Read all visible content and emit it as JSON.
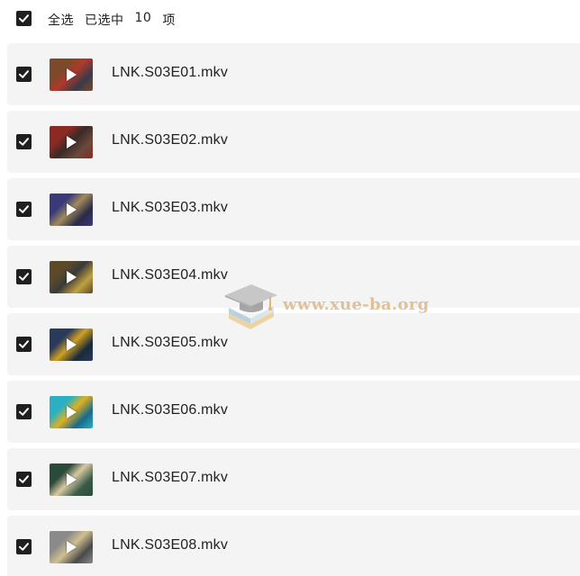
{
  "header": {
    "select_all_label": "全选",
    "selected_prefix": "已选中",
    "selected_count": "10",
    "selected_suffix": "项",
    "all_checked": true
  },
  "files": [
    {
      "name": "LNK.S03E01.mkv",
      "checked": true,
      "thumb_icon": "video-thumbnail",
      "thumb_colors": [
        "#7a4a2a",
        "#b0392b",
        "#3a3a4a"
      ]
    },
    {
      "name": "LNK.S03E02.mkv",
      "checked": true,
      "thumb_icon": "video-thumbnail",
      "thumb_colors": [
        "#8a2a22",
        "#3a2a2a",
        "#6a4a3a"
      ]
    },
    {
      "name": "LNK.S03E03.mkv",
      "checked": true,
      "thumb_icon": "video-thumbnail",
      "thumb_colors": [
        "#3a3a7a",
        "#a08a5a",
        "#2a2a4a"
      ]
    },
    {
      "name": "LNK.S03E04.mkv",
      "checked": true,
      "thumb_icon": "video-thumbnail",
      "thumb_colors": [
        "#5a4a2a",
        "#3a3a3a",
        "#c0a040"
      ]
    },
    {
      "name": "LNK.S03E05.mkv",
      "checked": true,
      "thumb_icon": "video-thumbnail",
      "thumb_colors": [
        "#2a3a5a",
        "#d0a020",
        "#1a2a3a"
      ]
    },
    {
      "name": "LNK.S03E06.mkv",
      "checked": true,
      "thumb_icon": "video-thumbnail",
      "thumb_colors": [
        "#2ab0c0",
        "#e0b020",
        "#1a6a8a"
      ]
    },
    {
      "name": "LNK.S03E07.mkv",
      "checked": true,
      "thumb_icon": "video-thumbnail",
      "thumb_colors": [
        "#2a4a3a",
        "#d8c8a0",
        "#3a5a4a"
      ]
    },
    {
      "name": "LNK.S03E08.mkv",
      "checked": true,
      "thumb_icon": "video-thumbnail",
      "thumb_colors": [
        "#8a8a8a",
        "#d0c090",
        "#4a4a4a"
      ]
    }
  ],
  "watermark": {
    "text": "www.xue-ba.org",
    "icon": "graduation-cap-books-icon"
  },
  "colors": {
    "row_background": "#f4f4f4",
    "checkbox": "#1f1f1f",
    "text": "#222222",
    "watermark": "#d9b07a"
  }
}
